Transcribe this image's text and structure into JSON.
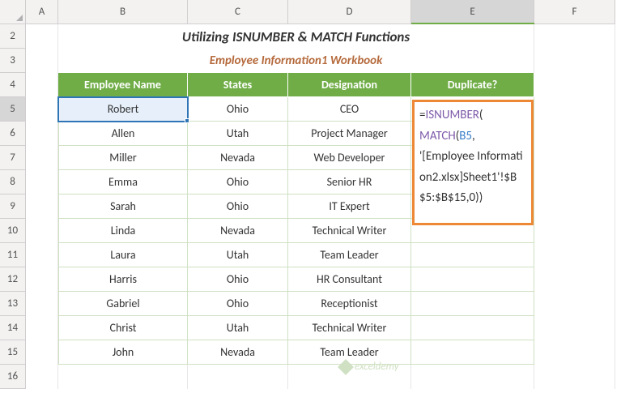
{
  "columns": [
    "A",
    "B",
    "C",
    "D",
    "E",
    "F"
  ],
  "rows": [
    "2",
    "3",
    "4",
    "5",
    "6",
    "7",
    "8",
    "9",
    "10",
    "11",
    "12",
    "13",
    "14",
    "15",
    "16"
  ],
  "active_col": "E",
  "active_row": "5",
  "title": "Utilizing ISNUMBER & MATCH Functions",
  "subtitle": "Employee Information1 Workbook",
  "headers": {
    "b": "Employee Name",
    "c": "States",
    "d": "Designation",
    "e": "Duplicate?"
  },
  "data": [
    {
      "name": "Robert",
      "state": "Ohio",
      "desig": "CEO"
    },
    {
      "name": "Allen",
      "state": "Utah",
      "desig": "Project Manager"
    },
    {
      "name": "Miller",
      "state": "Nevada",
      "desig": "Web Developer"
    },
    {
      "name": "Emma",
      "state": "Ohio",
      "desig": "Senior HR"
    },
    {
      "name": "Sarah",
      "state": "Ohio",
      "desig": "IT Expert"
    },
    {
      "name": "Linda",
      "state": "Nevada",
      "desig": "Technical Writer"
    },
    {
      "name": "Laura",
      "state": "Utah",
      "desig": "Team Leader"
    },
    {
      "name": "Harris",
      "state": "Ohio",
      "desig": "HR Consultant"
    },
    {
      "name": "Gabriel",
      "state": "Ohio",
      "desig": "Receptionist"
    },
    {
      "name": "Christ",
      "state": "Utah",
      "desig": "Technical Writer"
    },
    {
      "name": "John",
      "state": "Nevada",
      "desig": "Team Leader"
    }
  ],
  "formula": {
    "raw": "=ISNUMBER(MATCH(B5,'[Employee Information2.xlsx]Sheet1'!$B$5:$B$15,0))",
    "parts": {
      "eq": "=",
      "fn1": "ISNUMBER",
      "p1": "(",
      "fn2": "MATCH",
      "p2": "(",
      "ref1": "B5",
      "sep1": ",",
      "ref2": "'[Employee Information2.xlsx]Sheet1'!$B$5:$B$15",
      "sep2": ",0",
      "close": "))"
    }
  },
  "watermark": "exceldemy"
}
